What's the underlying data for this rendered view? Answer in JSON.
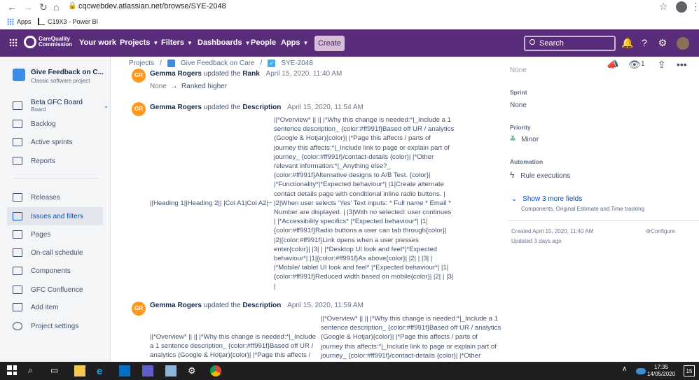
{
  "browser": {
    "url": "cqcwebdev.atlassian.net/browse/SYE-2048",
    "bookmarks": [
      {
        "label": "Apps"
      },
      {
        "label": "C19X3 - Power BI"
      }
    ]
  },
  "topbar": {
    "logo_line1": "CareQuality",
    "logo_line2": "Commission",
    "nav": [
      {
        "label": "Your work",
        "dropdown": false
      },
      {
        "label": "Projects",
        "dropdown": true
      },
      {
        "label": "Filters",
        "dropdown": true
      },
      {
        "label": "Dashboards",
        "dropdown": true
      },
      {
        "label": "People",
        "dropdown": false
      },
      {
        "label": "Apps",
        "dropdown": true
      }
    ],
    "create_label": "Create",
    "search_placeholder": "Search"
  },
  "sidebar": {
    "project_name": "Give Feedback on C...",
    "project_type": "Classic software project",
    "board_name": "Beta GFC Board",
    "board_sub": "Board",
    "items": [
      {
        "label": "Backlog",
        "icon": "backlog-icon"
      },
      {
        "label": "Active sprints",
        "icon": "sprints-icon"
      },
      {
        "label": "Reports",
        "icon": "reports-icon"
      },
      {
        "label": "Releases",
        "icon": "releases-icon"
      },
      {
        "label": "Issues and filters",
        "icon": "issues-icon",
        "active": true
      },
      {
        "label": "Pages",
        "icon": "pages-icon"
      },
      {
        "label": "On-call schedule",
        "icon": "schedule-icon"
      },
      {
        "label": "Components",
        "icon": "components-icon"
      },
      {
        "label": "GFC Confluence",
        "icon": "confluence-icon"
      },
      {
        "label": "Add item",
        "icon": "add-item-icon"
      },
      {
        "label": "Project settings",
        "icon": "settings-icon"
      }
    ]
  },
  "breadcrumb": {
    "root": "Projects",
    "project": "Give Feedback on Care",
    "issue": "SYE-2048"
  },
  "watchers_count": "1",
  "history": [
    {
      "avatar": "GR",
      "author": "Gemma Rogers",
      "action": "updated the",
      "field": "Rank",
      "time": "April 15, 2020, 11:40 AM",
      "from": "None",
      "to": "Ranked higher"
    },
    {
      "avatar": "GR",
      "author": "Gemma Rogers",
      "action": "updated the",
      "field": "Description",
      "time": "April 15, 2020, 11:54 AM",
      "from": "||Heading 1||Heading 2|| |Col A1|Col A2|",
      "to_lines": [
        "||*Overview* || || |*Why this change is needed:*|_Include a 1",
        "sentence description_ {color:#ff991f}Based off UR / analytics",
        "(Google & Hotjar){color}| |*Page this affects / parts of",
        "journey this affects:*|_Include link to page or explain part of",
        "journey_ {color:#ff991f}/contact-details {color}| |*Other",
        "relevant information:*|_Anything else?_",
        "{color:#ff991f}Alternative designs to A/B Test. {color}|",
        "|*Functionality*|*Expected behaviour*| |1|Create alternate",
        "contact details page with conditional inline radio buttons. |",
        "|2|When user selects 'Yes' Text inputs: * Full name * Email *",
        "Number are displayed. | |3|With no selected: user continues",
        "| |*Accessibility specifics* |*Expected behaviour*| |1|",
        "{color:#ff991f}Radio buttons a user can tab through{color}|",
        "|2|{color:#ff991f}Link opens when a user presses",
        "enter{color}| |3| | |*Desktop UI look and feel*|*Expected",
        "behaviour*| |1|{color:#ff991f}As above{color}| |2| | |3| |",
        "|*Mobile/ tablet UI look and feel* |*Expected behaviour*| |1|",
        "{color:#ff991f}Reduced width based on mobile{color}| |2| | |3|",
        "|"
      ]
    },
    {
      "avatar": "GR",
      "author": "Gemma Rogers",
      "action": "updated the",
      "field": "Description",
      "time": "April 15, 2020, 11:59 AM",
      "from_lines": [
        "||*Overview* || || |*Why this change is needed:*|_Include",
        "a 1 sentence description_ {color:#ff991f}Based off UR /",
        "analytics (Google & Hotjar){color}| |*Page this affects /"
      ],
      "to_lines": [
        "||*Overview* || || |*Why this change is needed:*|_Include a 1",
        "sentence description_ {color:#ff991f}Based off UR / analytics",
        "(Google & Hotjar){color}| |*Page this affects / parts of",
        "journey this affects:*|_Include link to page or explain part of",
        "journey_ {color:#ff991f}/contact-details {color}| |*Other"
      ]
    }
  ],
  "details": {
    "top_value": "None",
    "sprint_label": "Sprint",
    "sprint_value": "None",
    "priority_label": "Priority",
    "priority_value": "Minor",
    "automation_label": "Automation",
    "automation_value": "Rule executions",
    "show_more": "Show 3 more fields",
    "show_more_sub": "Components, Original Estimate and Time tracking",
    "created": "Created April 15, 2020, 11:40 AM",
    "updated": "Updated 3 days ago",
    "configure": "Configure"
  },
  "taskbar": {
    "time": "17:35",
    "date": "14/05/2020",
    "notifications": "15"
  }
}
